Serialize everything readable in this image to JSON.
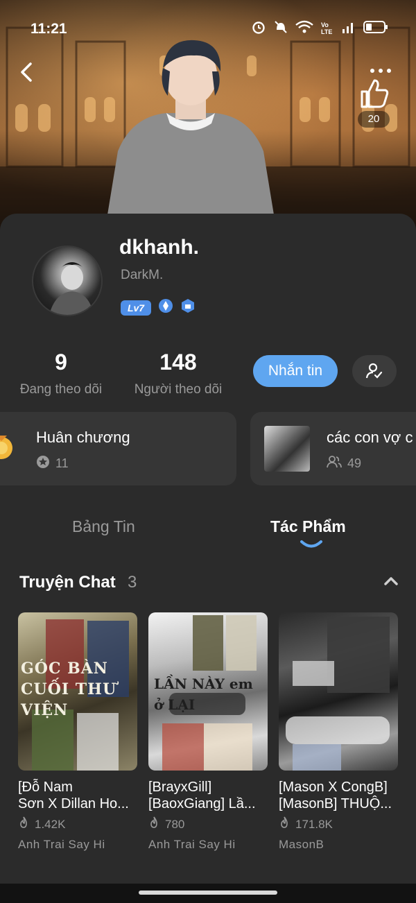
{
  "status_bar": {
    "time": "11:21"
  },
  "header": {
    "like_count": "20"
  },
  "profile": {
    "username": "dkhanh.",
    "handle": "DarkM.",
    "level": "Lv7"
  },
  "stats": {
    "following_count": "9",
    "following_label": "Đang theo dõi",
    "followers_count": "148",
    "followers_label": "Người theo dõi"
  },
  "actions": {
    "message_label": "Nhắn tin"
  },
  "tiles": {
    "medal": {
      "title": "Huân chương",
      "count": "11"
    },
    "collection": {
      "title": "các con vợ c",
      "count": "49"
    }
  },
  "tabs": [
    {
      "label": "Bảng Tin"
    },
    {
      "label": "Tác Phẩm"
    }
  ],
  "section": {
    "title": "Truyện Chat",
    "count": "3"
  },
  "stories": [
    {
      "title_line1": "[Đỗ Nam",
      "title_line2": "Sơn X Dillan Ho...",
      "views": "1.42K",
      "author": "Anh Trai Say Hi",
      "cover_text": "GÓC BÀN CUỐI THƯ VIỆN"
    },
    {
      "title_line1": "[BrayxGill]",
      "title_line2": "[BaoxGiang] Lầ...",
      "views": "780",
      "author": "Anh Trai Say Hi",
      "cover_text": "LẦN NÀY em ở LẠI"
    },
    {
      "title_line1": "[Mason X CongB]",
      "title_line2": "[MasonB] THUỘ...",
      "views": "171.8K",
      "author": "MasonB",
      "cover_text": ""
    }
  ],
  "colors": {
    "accent": "#5fa6f0",
    "background": "#2b2b2b",
    "tile": "#363636",
    "muted_text": "#9a9a9a",
    "level_badge": "#4f8fe8"
  },
  "icons": [
    "back-arrow-icon",
    "more-icon",
    "thumbs-up-icon",
    "user-check-icon",
    "medal-icon",
    "star-icon",
    "people-icon",
    "chevron-up-icon",
    "fire-icon"
  ]
}
